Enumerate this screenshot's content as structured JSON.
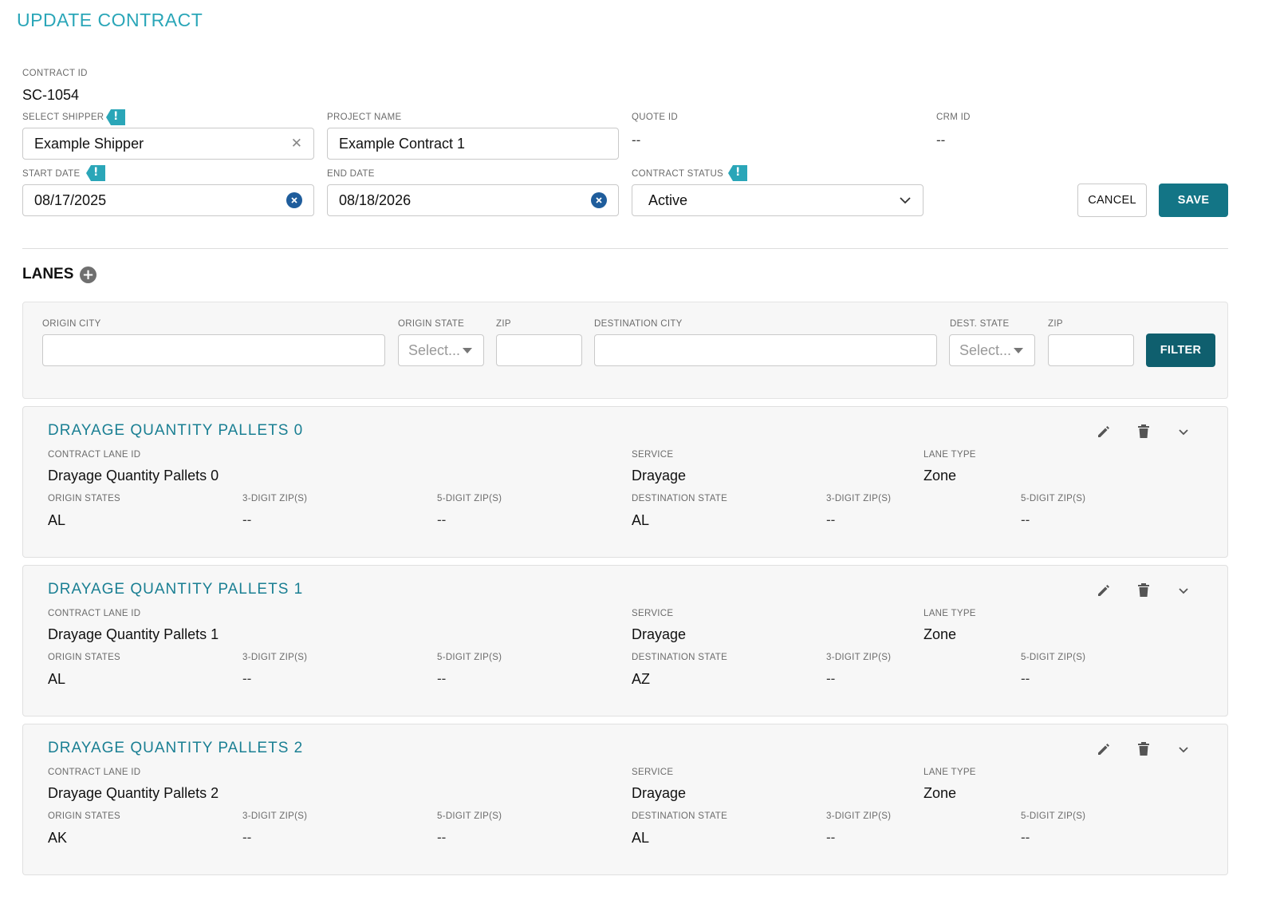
{
  "page": {
    "title": "UPDATE CONTRACT"
  },
  "contract": {
    "contract_id_label": "CONTRACT ID",
    "contract_id": "SC-1054",
    "shipper_label": "SELECT SHIPPER",
    "shipper": "Example Shipper",
    "project_label": "PROJECT NAME",
    "project": "Example Contract 1",
    "quote_label": "QUOTE ID",
    "quote": "--",
    "crm_label": "CRM ID",
    "crm": "--",
    "start_label": "START DATE",
    "start": "08/17/2025",
    "end_label": "END DATE",
    "end": "08/18/2026",
    "status_label": "CONTRACT STATUS",
    "status": "Active"
  },
  "actions": {
    "cancel": "CANCEL",
    "save": "SAVE"
  },
  "lanes": {
    "title": "LANES",
    "filter": {
      "origin_city": "ORIGIN CITY",
      "origin_state": "ORIGIN STATE",
      "zip1": "ZIP",
      "destination_city": "DESTINATION CITY",
      "dest_state": "DEST. STATE",
      "zip2": "ZIP",
      "select_placeholder": "Select...",
      "button": "FILTER"
    },
    "labels": {
      "lane_id": "CONTRACT LANE ID",
      "service": "SERVICE",
      "lane_type": "LANE TYPE",
      "origin_states": "ORIGIN STATES",
      "zip3": "3-DIGIT ZIP(S)",
      "zip5": "5-DIGIT ZIP(S)",
      "dest_state": "DESTINATION STATE"
    },
    "items": [
      {
        "title": "DRAYAGE QUANTITY PALLETS 0",
        "lane_id": "Drayage Quantity Pallets 0",
        "service": "Drayage",
        "lane_type": "Zone",
        "origin_states": "AL",
        "o_zip3": "--",
        "o_zip5": "--",
        "dest_state": "AL",
        "d_zip3": "--",
        "d_zip5": "--"
      },
      {
        "title": "DRAYAGE QUANTITY PALLETS 1",
        "lane_id": "Drayage Quantity Pallets 1",
        "service": "Drayage",
        "lane_type": "Zone",
        "origin_states": "AL",
        "o_zip3": "--",
        "o_zip5": "--",
        "dest_state": "AZ",
        "d_zip3": "--",
        "d_zip5": "--"
      },
      {
        "title": "DRAYAGE QUANTITY PALLETS 2",
        "lane_id": "Drayage Quantity Pallets 2",
        "service": "Drayage",
        "lane_type": "Zone",
        "origin_states": "AK",
        "o_zip3": "--",
        "o_zip5": "--",
        "dest_state": "AL",
        "d_zip3": "--",
        "d_zip5": "--"
      }
    ]
  }
}
